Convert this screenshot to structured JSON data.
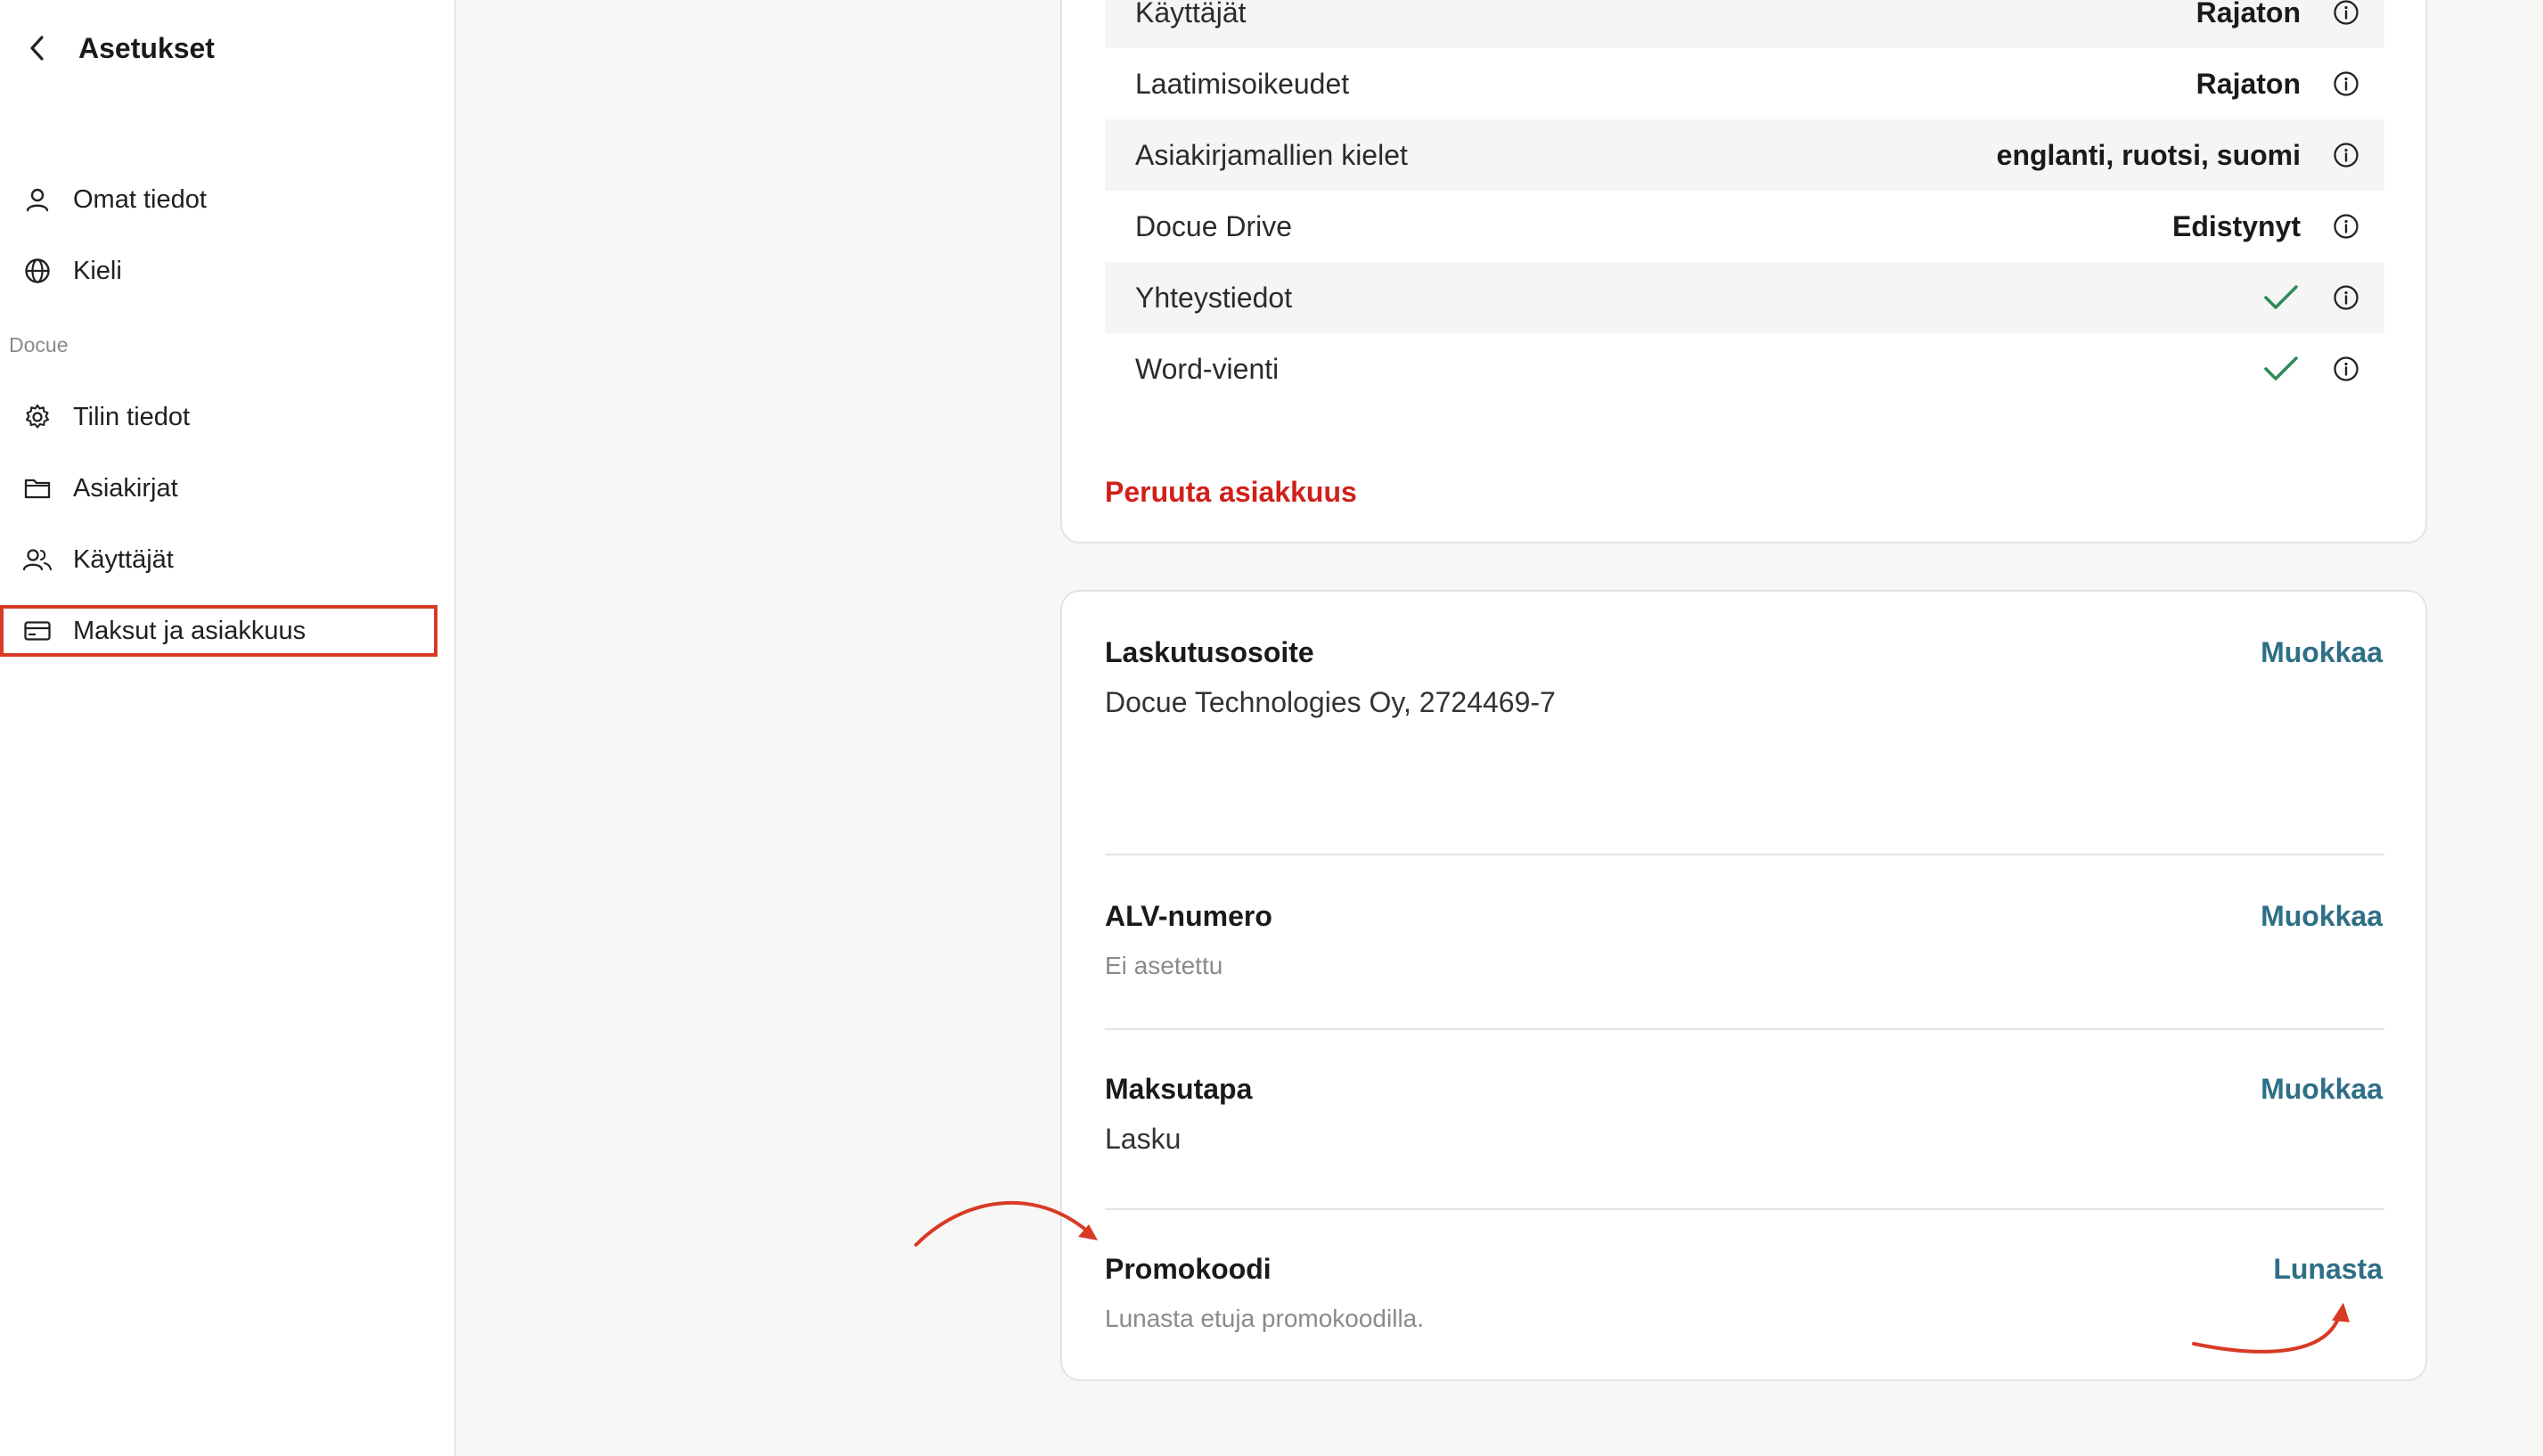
{
  "sidebar": {
    "title": "Asetukset",
    "items_top": [
      {
        "label": "Omat tiedot",
        "icon": "user-icon"
      },
      {
        "label": "Kieli",
        "icon": "globe-icon"
      }
    ],
    "section_label": "Docue",
    "items_docue": [
      {
        "label": "Tilin tiedot",
        "icon": "gear-icon"
      },
      {
        "label": "Asiakirjat",
        "icon": "folder-icon"
      },
      {
        "label": "Käyttäjät",
        "icon": "users-icon"
      },
      {
        "label": "Maksut ja asiakkuus",
        "icon": "credit-card-icon",
        "active": true
      }
    ]
  },
  "features": {
    "rows": [
      {
        "label": "Käyttäjät",
        "value": "Rajaton"
      },
      {
        "label": "Laatimisoikeudet",
        "value": "Rajaton"
      },
      {
        "label": "Asiakirjamallien kielet",
        "value": "englanti, ruotsi, suomi"
      },
      {
        "label": "Docue Drive",
        "value": "Edistynyt"
      },
      {
        "label": "Yhteystiedot",
        "value": "included"
      },
      {
        "label": "Word-vienti",
        "value": "included"
      }
    ],
    "cancel_label": "Peruuta asiakkuus"
  },
  "billing": {
    "address": {
      "title": "Laskutusosoite",
      "value": "Docue Technologies Oy, 2724469-7",
      "action": "Muokkaa"
    },
    "vat": {
      "title": "ALV-numero",
      "value": "Ei asetettu",
      "action": "Muokkaa"
    },
    "payment": {
      "title": "Maksutapa",
      "value": "Lasku",
      "action": "Muokkaa"
    },
    "promo": {
      "title": "Promokoodi",
      "value": "Lunasta etuja promokoodilla.",
      "action": "Lunasta"
    }
  },
  "colors": {
    "accent": "#2e6f86",
    "danger": "#d0201a",
    "check": "#2f8a5c",
    "annotation": "#d83a26"
  }
}
